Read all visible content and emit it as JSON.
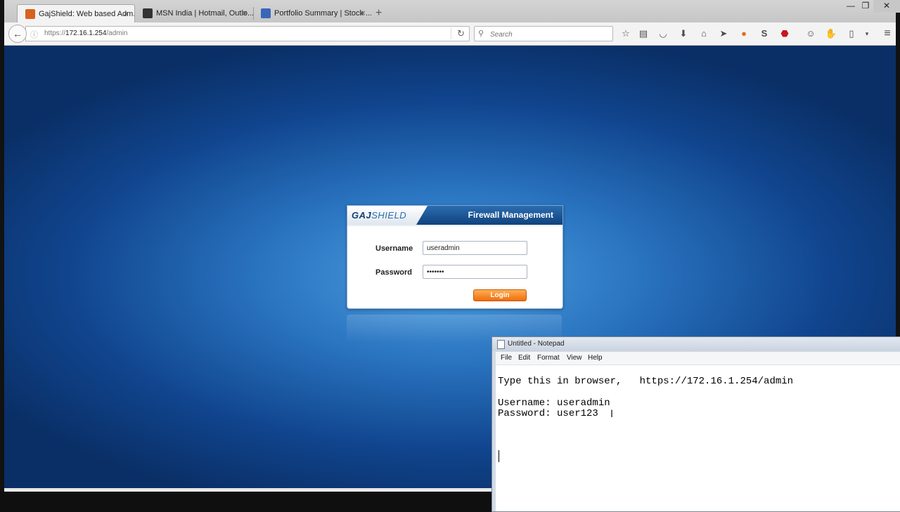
{
  "browser": {
    "tabs": [
      {
        "label": "GajShield: Web based Adm...",
        "favicon_color": "#d8621e",
        "active": true
      },
      {
        "label": "MSN India | Hotmail, Outlo...",
        "favicon_color": "#333333",
        "active": false
      },
      {
        "label": "Portfolio Summary | Stock ...",
        "favicon_color": "#3a66b8",
        "active": false
      }
    ],
    "tab_close_glyph": "×",
    "new_tab_glyph": "+",
    "window_controls": {
      "minimize": "—",
      "maximize": "❐",
      "close": "✕"
    },
    "url": {
      "scheme": "https://",
      "host": "172.16.1.254",
      "path": "/admin"
    },
    "search_placeholder": "Search",
    "toolbar_icons": [
      "bookmark-star-icon",
      "reading-list-icon",
      "pocket-icon",
      "download-icon",
      "home-icon",
      "send-icon",
      "duckduckgo-icon",
      "s-extension-icon",
      "adblock-plus-icon",
      "chat-icon",
      "extension-icon",
      "clipboard-icon",
      "overflow-icon",
      "hamburger-menu-icon"
    ]
  },
  "login": {
    "logo_bold": "GAJ",
    "logo_light": "SHIELD",
    "title": "Firewall Management",
    "username_label": "Username",
    "username_value": "useradmin",
    "password_label": "Password",
    "password_mask": "•••••••",
    "login_button": "Login",
    "colors": {
      "header": "#1a5596",
      "button": "#f27b19"
    }
  },
  "notepad": {
    "title": "Untitled - Notepad",
    "menu": [
      "File",
      "Edit",
      "Format",
      "View",
      "Help"
    ],
    "lines": [
      "Type this in browser,   https://172.16.1.254/admin",
      "",
      "Username: useradmin",
      "Password: user123"
    ]
  }
}
